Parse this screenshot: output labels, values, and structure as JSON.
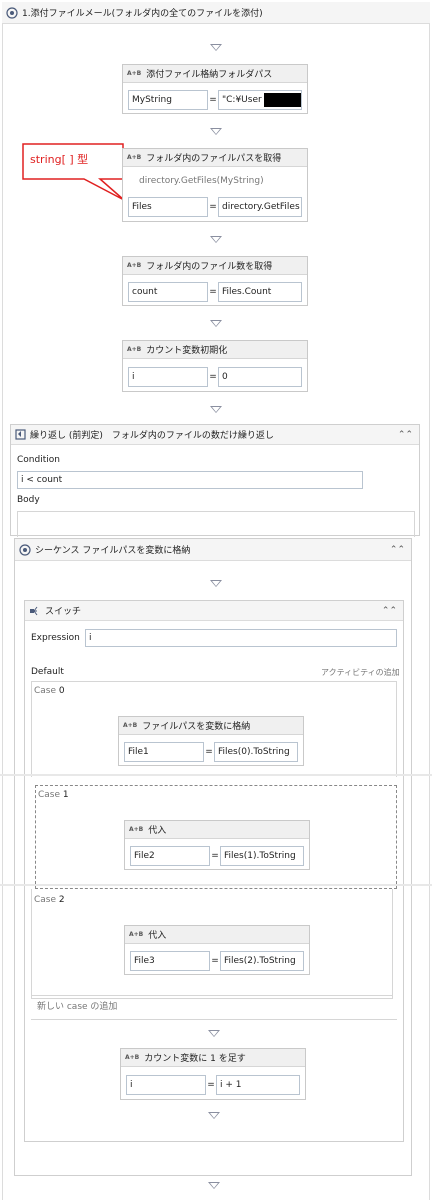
{
  "main_sequence": {
    "title": "1.添付ファイルメール(フォルダ内の全てのファイルを添付)"
  },
  "activities": {
    "folder_path": {
      "title": "添付ファイル格納フォルダパス",
      "left": "MyString",
      "right": "\"C:¥User"
    },
    "get_files": {
      "title": "フォルダ内のファイルパスを取得",
      "expression": "directory.GetFiles(MyString)",
      "left": "Files",
      "right": "directory.GetFiles"
    },
    "file_count": {
      "title": "フォルダ内のファイル数を取得",
      "left": "count",
      "right": "Files.Count"
    },
    "init_counter": {
      "title": "カウント変数初期化",
      "left": "i",
      "right": "0"
    }
  },
  "callout": {
    "text": "string[ ] 型"
  },
  "while_loop": {
    "title": "繰り返し (前判定)　フォルダ内のファイルの数だけ繰り返し",
    "condition_label": "Condition",
    "condition_value": "i < count",
    "body_label": "Body"
  },
  "inner_sequence": {
    "title": "シーケンス  ファイルパスを変数に格納"
  },
  "switch": {
    "title": "スイッチ",
    "expression_label": "Expression",
    "expression_value": "i",
    "default_label": "Default",
    "add_activity": "アクティビティの追加",
    "add_case": "新しい case の追加",
    "cases": [
      {
        "word": "Case",
        "num": "0",
        "title": "ファイルパスを変数に格納",
        "left": "File1",
        "right": "Files(0).ToString"
      },
      {
        "word": "Case",
        "num": "1",
        "title": "代入",
        "left": "File2",
        "right": "Files(1).ToString"
      },
      {
        "word": "Case",
        "num": "2",
        "title": "代入",
        "left": "File3",
        "right": "Files(2).ToString"
      }
    ]
  },
  "increment": {
    "title": "カウント変数に 1 を足す",
    "left": "i",
    "right": "i + 1"
  },
  "assign_badge": "A+B",
  "equals": "=",
  "colors": {
    "callout_border": "#e02020",
    "callout_text": "#e02020",
    "header_bg": "#f0f0f0",
    "border": "#c9c9c9"
  }
}
